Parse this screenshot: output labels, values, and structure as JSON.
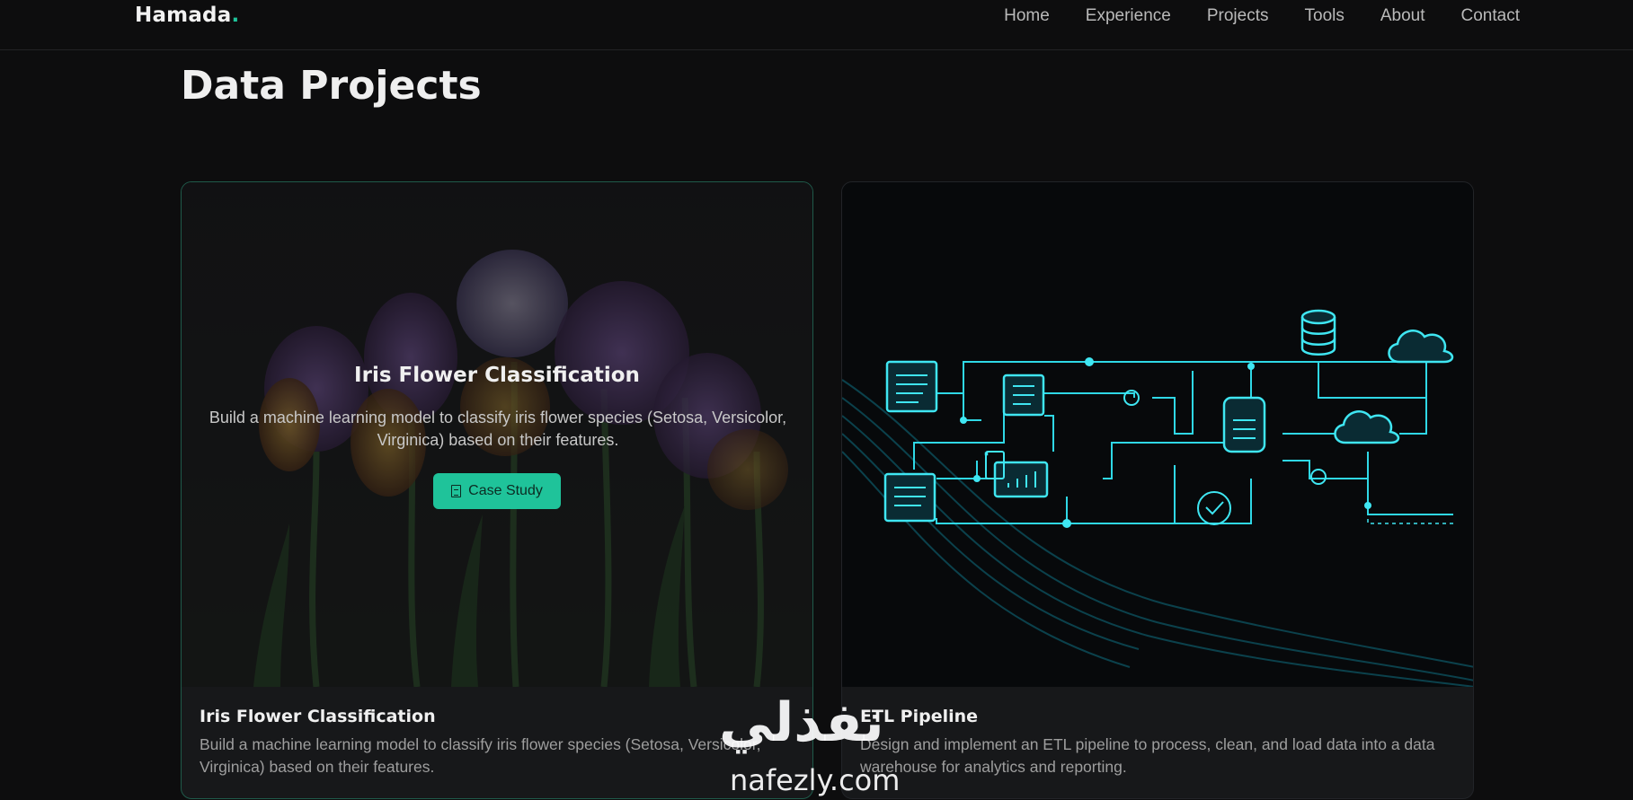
{
  "brand": {
    "name": "Hamada",
    "dot": ".",
    "accent": "#1fc39a"
  },
  "nav": {
    "items": [
      {
        "label": "Home"
      },
      {
        "label": "Experience"
      },
      {
        "label": "Projects"
      },
      {
        "label": "Tools"
      },
      {
        "label": "About"
      },
      {
        "label": "Contact"
      }
    ]
  },
  "section": {
    "title": "Data Projects"
  },
  "projects": [
    {
      "title": "Iris Flower Classification",
      "description": "Build a machine learning model to classify iris flower species (Setosa, Versicolor, Virginica) based on their features.",
      "button_label": "Case Study",
      "button_icon": "document-icon"
    },
    {
      "title": "ETL Pipeline",
      "description": "Design and implement an ETL pipeline to process, clean, and load data into a data warehouse for analytics and reporting."
    }
  ],
  "watermark": {
    "arabic": "نفذلي",
    "latin": "nafezly.com"
  }
}
